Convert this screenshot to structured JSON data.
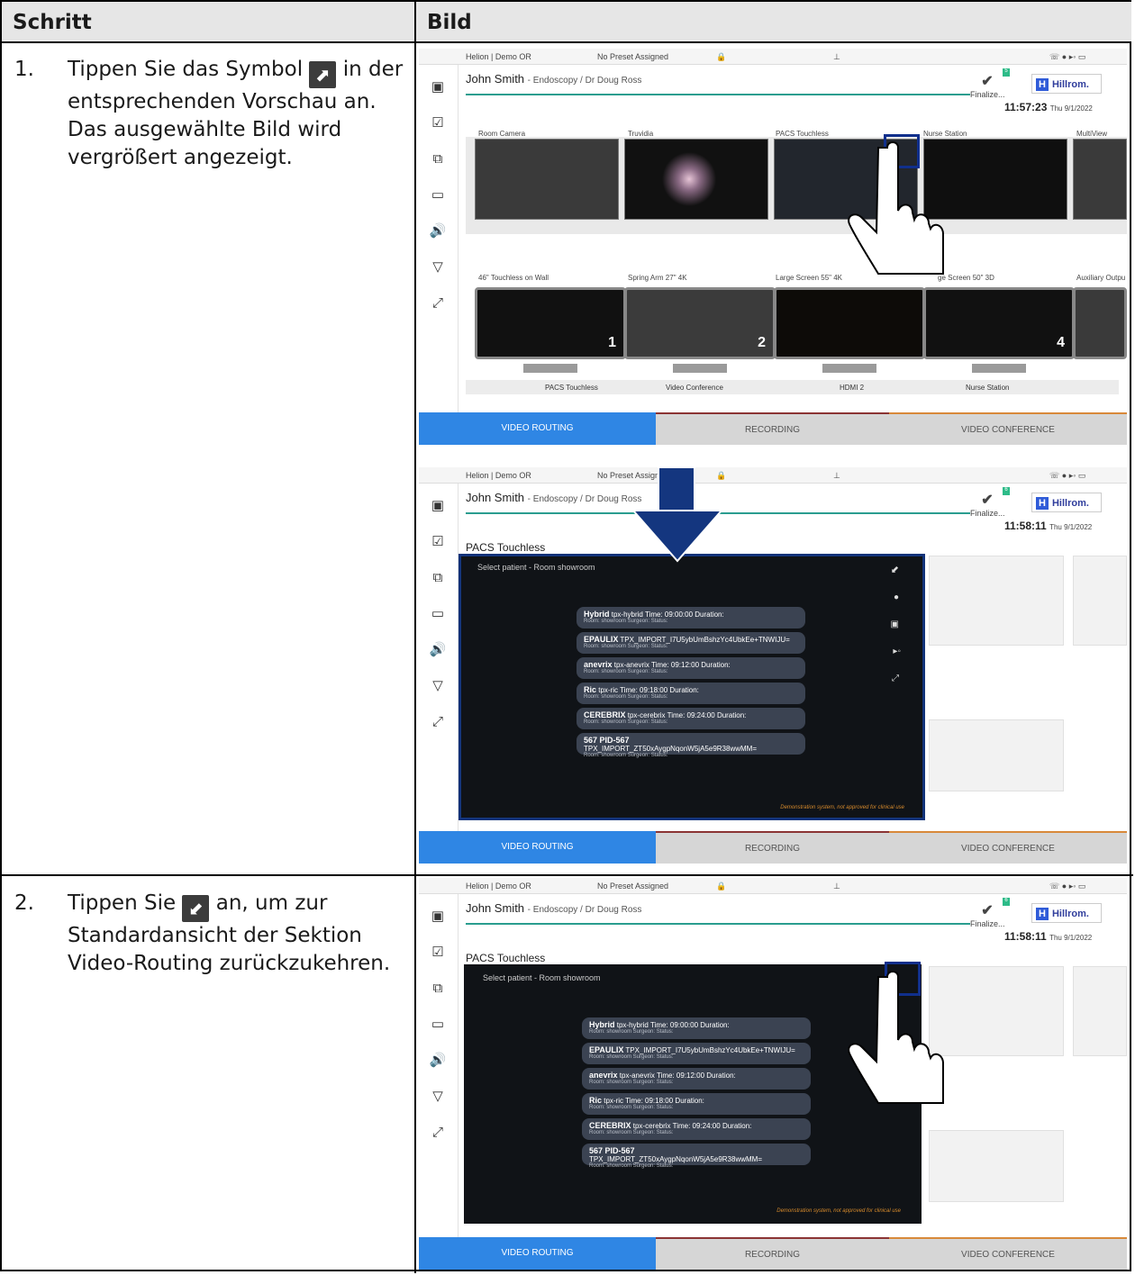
{
  "table": {
    "col1_header": "Schritt",
    "col2_header": "Bild"
  },
  "steps": [
    {
      "num": "1.",
      "line1a": "Tippen Sie das Symbol",
      "icon": "expand-icon",
      "line1b": "in der entsprechenden Vorschau an.",
      "line2": "Das ausgewählte Bild wird vergrößert angezeigt."
    },
    {
      "num": "2.",
      "line1a": "Tippen Sie",
      "icon": "collapse-icon",
      "line1b": "an, um zur Standardansicht der Sektion Video-Routing zurückzukehren."
    }
  ],
  "app": {
    "location": "Helion | Demo OR",
    "preset": "No Preset Assigned",
    "patient_name": "John Smith",
    "patient_info": "- Endoscopy / Dr Doug Ross",
    "finalize": "Finalize...",
    "badge": "5",
    "badge2": "6",
    "brand": "Hillrom.",
    "brand_mark": "H",
    "times": [
      "11:57:23",
      "11:58:11",
      "11:58:11"
    ],
    "date": "Thu 9/1/2022",
    "sources": [
      "Room Camera",
      "Truvidia",
      "PACS Touchless",
      "Nurse Station",
      "MultiView"
    ],
    "displays": [
      "46\" Touchless on Wall",
      "Spring Arm 27\" 4K",
      "Large Screen 55\" 4K",
      "ge Screen 50\" 3D",
      "Auxiliary Outpu"
    ],
    "display_nums": [
      "1",
      "2",
      "4"
    ],
    "routes": [
      "PACS Touchless",
      "Video Conference",
      "HDMI 2",
      "Nurse Station"
    ],
    "tabs": {
      "video_routing": "VIDEO ROUTING",
      "recording": "RECORDING",
      "video_conference": "VIDEO CONFERENCE"
    },
    "expanded_title": "PACS Touchless",
    "overlay_header": "Select patient - Room showroom",
    "footnote": "Demonstration system, not approved for clinical use",
    "patients": [
      {
        "name": "Hybrid",
        "id": "tpx-hybrid",
        "time": "Time: 09:00:00",
        "dur": "Duration:",
        "sub": "Room: showroom   Surgeon:   Status:"
      },
      {
        "name": "EPAULIX",
        "id": "TPX_IMPORT_I7U5ybUmBshzYc4UbkEe+TNWIJU=",
        "time": "Time",
        "dur": "",
        "sub": "Room: showroom   Surgeon:   Status:"
      },
      {
        "name": "anevrix",
        "id": "tpx-anevrix",
        "time": "Time: 09:12:00",
        "dur": "Duration:",
        "sub": "Room: showroom   Surgeon:   Status:"
      },
      {
        "name": "Ric",
        "id": "tpx-ric",
        "time": "Time: 09:18:00",
        "dur": "Duration:",
        "sub": "Room: showroom   Surgeon:   Status:"
      },
      {
        "name": "CEREBRIX",
        "id": "tpx-cerebrix",
        "time": "Time: 09:24:00",
        "dur": "Duration:",
        "sub": "Room: showroom   Surgeon:   Status:"
      },
      {
        "name": "567 PID-567",
        "id": "TPX_IMPORT_ZT50xAygpNqonW5jA5e9R38wwMM=",
        "time": "",
        "dur": "",
        "sub": "Room: showroom   Surgeon:   Status:"
      }
    ]
  }
}
